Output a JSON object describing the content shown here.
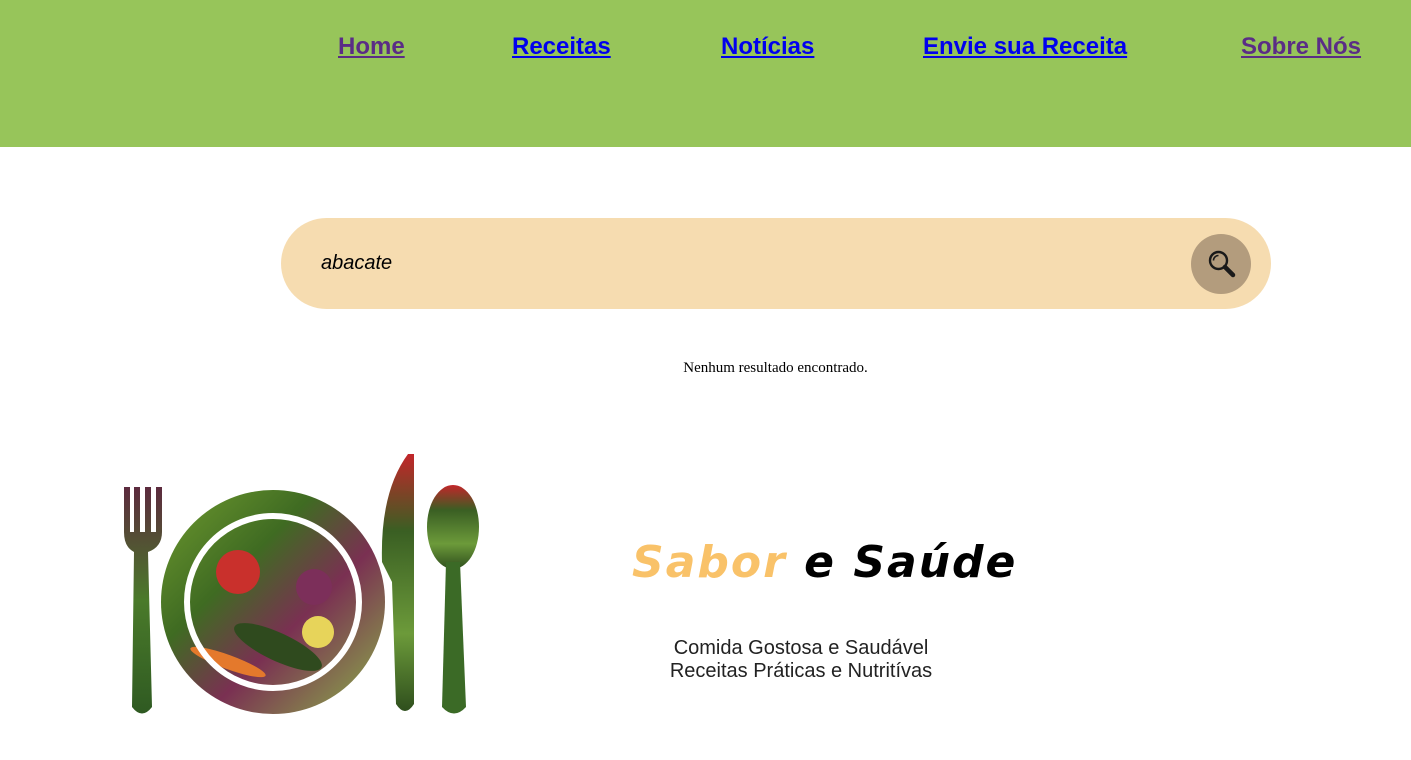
{
  "nav": {
    "items": [
      {
        "label": "Home",
        "state": "visited"
      },
      {
        "label": "Receitas",
        "state": "unvisited"
      },
      {
        "label": "Notícias",
        "state": "unvisited"
      },
      {
        "label": "Envie sua Receita",
        "state": "unvisited"
      },
      {
        "label": "Sobre Nós",
        "state": "visited"
      }
    ],
    "colors": {
      "bar": "#97c55a",
      "visited": "#5a2d86",
      "unvisited": "#0000ee"
    }
  },
  "search": {
    "value": "abacate",
    "button_icon": "search-icon",
    "colors": {
      "bar": "#f6dcb0",
      "button": "#b39c7d"
    }
  },
  "results": {
    "message": "Nenhum resultado encontrado."
  },
  "brand": {
    "title_part1": "Sabor",
    "title_part2": "e",
    "title_part3": "Saúde",
    "tagline_line1": "Comida Gostosa e Saudável",
    "tagline_line2": "Receitas Práticas e Nutritívas",
    "accent_color": "#f9c269",
    "logo_icon": "fork-plate-knife-spoon-icon"
  }
}
